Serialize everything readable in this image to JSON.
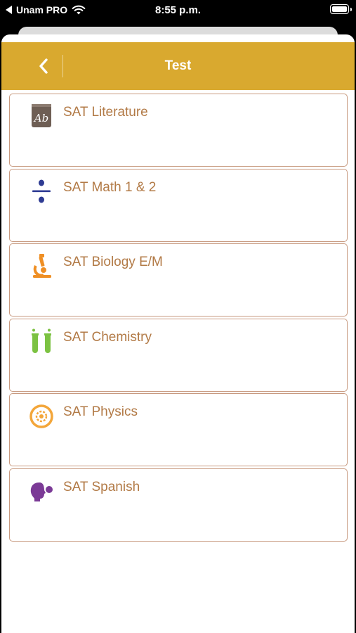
{
  "status_bar": {
    "carrier": "Unam PRO",
    "time": "8:55 p.m."
  },
  "nav": {
    "title": "Test",
    "back_icon": "chevron-left-icon"
  },
  "colors": {
    "nav_background": "#d9a92f",
    "item_label": "#b27a46",
    "item_border": "#c89a80"
  },
  "tests": [
    {
      "label": "SAT Literature",
      "icon": "book-ab-icon",
      "icon_color": "#6e5e54"
    },
    {
      "label": "SAT Math 1 & 2",
      "icon": "divide-icon",
      "icon_color": "#2e3b93"
    },
    {
      "label": "SAT Biology E/M",
      "icon": "microscope-icon",
      "icon_color": "#ef8f24"
    },
    {
      "label": "SAT Chemistry",
      "icon": "test-tubes-icon",
      "icon_color": "#7cc242"
    },
    {
      "label": "SAT Physics",
      "icon": "atom-gear-icon",
      "icon_color": "#f3a63a"
    },
    {
      "label": "SAT Spanish",
      "icon": "speech-head-icon",
      "icon_color": "#7b3a96"
    }
  ]
}
